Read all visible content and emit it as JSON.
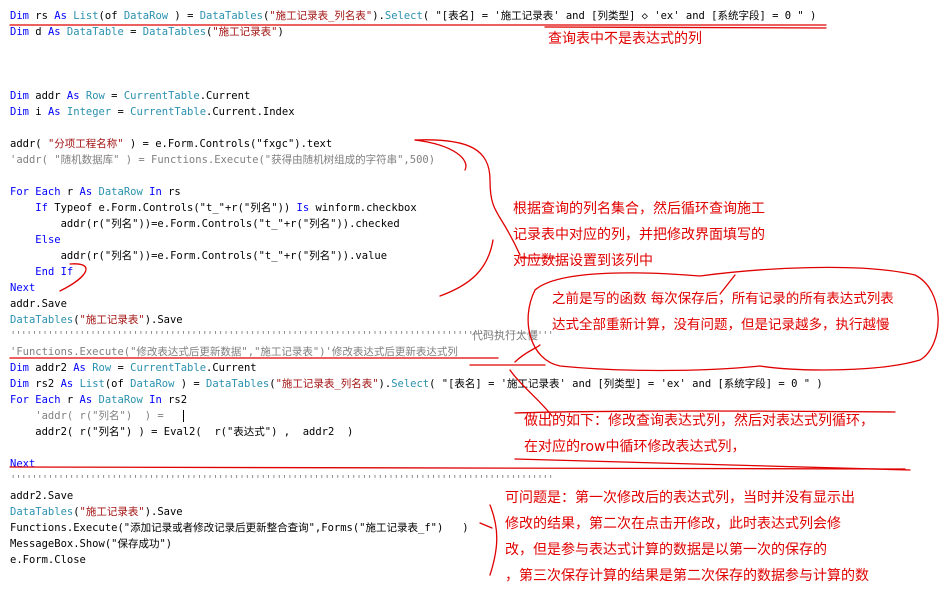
{
  "code": {
    "l1": {
      "a": "Dim rs As List(of DataRow ) = DataTables(",
      "s1": "\"施工记录表_列名表\"",
      ".b": "",
      "b": ").Select( \"[表名] = '施工记录表' and [列类型] ◇ 'ex' and [系统字段] = 0 \" )"
    },
    "l2": {
      "a": "Dim d As DataTable = DataTables(",
      "s1": "\"施工记录表\"",
      "b": ")"
    },
    "l3": "Dim addr As Row = CurrentTable.Current",
    "l4": "Dim i As Integer = CurrentTable.Current.Index",
    "l5": {
      "a": "addr( ",
      "s1": "\"分项工程名称\"",
      "b": " ) = e.Form.Controls(\"fxgc\").text"
    },
    "l6": "'addr( \"随机数据库\" ) = Functions.Execute(\"获得由随机树组成的字符串\",500)",
    "l7": "For Each r As DataRow In rs",
    "l8": "    If Typeof e.Form.Controls(\"t_\"+r(\"列名\")) Is winform.checkbox",
    "l9": "        addr(r(\"列名\"))=e.Form.Controls(\"t_\"+r(\"列名\")).checked",
    "l10": "    Else",
    "l11": "        addr(r(\"列名\"))=e.Form.Controls(\"t_\"+r(\"列名\")).value",
    "l12": "    End If",
    "l13": "Next",
    "l14": "addr.Save",
    "l15": {
      "a": "DataTables(",
      "s1": "\"施工记录表\"",
      "b": ").Save"
    },
    "l16": "''''''''''''''''''''''''''''''''''''''''''''''''''''''''''''''''''''''''''''''''''''''''''''''''''''''",
    "l16b": "代码执行太慢",
    "l17": "'Functions.Execute(\"修改表达式后更新数据\",\"施工记录表\")'修改表达式后更新表达式列",
    "l18": "Dim addr2 As Row = CurrentTable.Current",
    "l19": {
      "a": "Dim rs2 As List(of DataRow ) = DataTables(",
      "s1": "\"施工记录表_列名表\"",
      "b": ").Select( \"[表名] = '施工记录表' and [列类型] = 'ex' and [系统字段] = 0 \" )"
    },
    "l20": "For Each r As DataRow In rs2",
    "l21": "    'addr( r(\"列名\")  ) =",
    "l22": "    addr2( r(\"列名\") ) = Eval2(  r(\"表达式\") ,  addr2  )",
    "l23": "Next",
    "l24": "''''''''''''''''''''''''''''''''''''''''''''''''''''''''''''''''''''''''''''''''''''''''''''''''''''''",
    "l25": "addr2.Save",
    "l26": {
      "a": "DataTables(",
      "s1": "\"施工记录表\"",
      "b": ").Save"
    },
    "l27": "Functions.Execute(\"添加记录或者修改记录后更新整合查询\",Forms(\"施工记录表_f\")   )",
    "l28": "MessageBox.Show(\"保存成功\")",
    "l29": "e.Form.Close"
  },
  "notes": {
    "n1": "查询表中不是表达式的列",
    "n2": "根据查询的列名集合，然后循环查询施工\n记录表中对应的列，并把修改界面填写的\n对应数据设置到该列中",
    "n3": "之前是写的函数 每次保存后，所有记录的所有表达式列表\n达式全部重新计算，没有问题，但是记录越多，执行越慢",
    "n4": "做出的如下：修改查询表达式列，然后对表达式列循环，\n在对应的row中循环修改表达式列，",
    "n5": "可问题是：第一次修改后的表达式列，当时并没有显示出\n修改的结果，第二次在点击开修改，此时表达式列会修\n改，但是参与表达式计算的数据是以第一次的保存的\n，第三次保存计算的结果是第二次保存的数据参与计算的数"
  },
  "colors": {
    "keyword": "#0000ff",
    "type": "#2b91af",
    "string": "#a31515",
    "comment": "#808080",
    "annotation": "#e00000"
  }
}
